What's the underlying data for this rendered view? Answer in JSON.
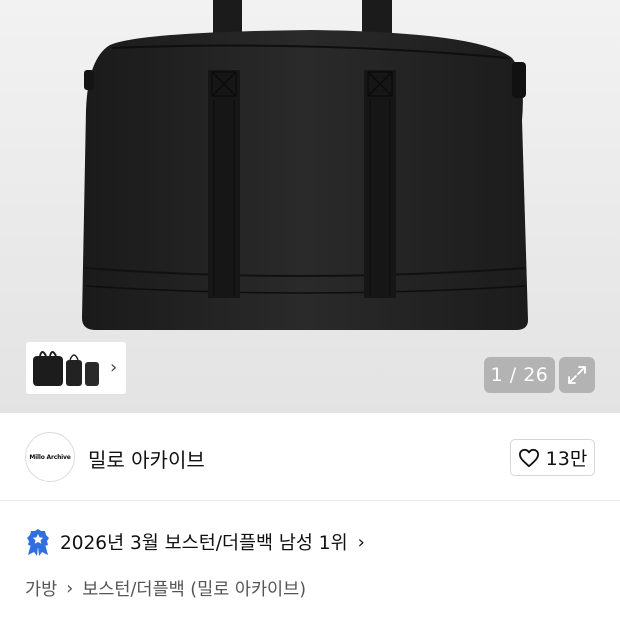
{
  "gallery": {
    "counter": "1 / 26",
    "thumbnail_next_icon": "chevron-right-icon",
    "expand_icon": "expand-icon"
  },
  "brand": {
    "logo_text": "Millo Archive",
    "name": "밀로 아카이브",
    "like_count": "13만",
    "like_icon": "heart-outline-icon"
  },
  "ranking": {
    "text": "2026년 3월 보스턴/더플백 남성 1위",
    "badge_icon": "star-medal-icon",
    "badge_color": "#2f6fe0"
  },
  "breadcrumb": {
    "level1": "가방",
    "level2": "보스턴/더플백 (밀로 아카이브)"
  }
}
